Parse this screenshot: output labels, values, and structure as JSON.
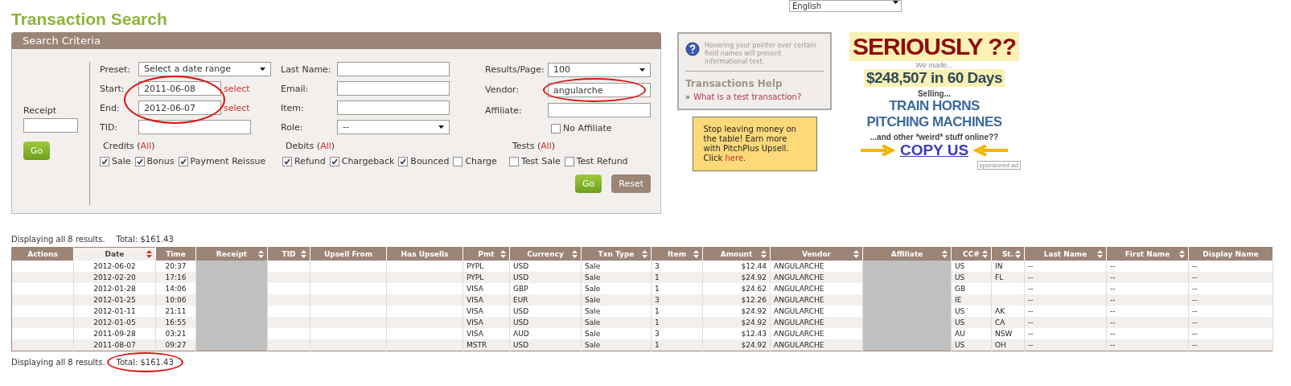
{
  "title": "Transaction Search",
  "language": {
    "value": "English"
  },
  "search_criteria": {
    "title": "Search Criteria",
    "receipt": {
      "label": "Receipt",
      "button": "Go"
    },
    "columns": [
      [
        {
          "kind": "select",
          "label": "Preset:",
          "value": "Select a date range"
        },
        {
          "kind": "date",
          "label": "Start:",
          "value": "2011-06-08",
          "link": "select"
        },
        {
          "kind": "date",
          "label": "End:",
          "value": "2012-06-07",
          "link": "select"
        },
        {
          "kind": "input",
          "label": "TID:"
        }
      ],
      [
        {
          "kind": "input",
          "label": "Last Name:"
        },
        {
          "kind": "input",
          "label": "Email:"
        },
        {
          "kind": "input",
          "label": "Item:"
        },
        {
          "kind": "select",
          "label": "Role:",
          "value": "--"
        }
      ],
      [
        {
          "kind": "select",
          "label": "Results/Page:",
          "value": "100"
        },
        {
          "kind": "input",
          "label": "Vendor:",
          "value": "angularche"
        },
        {
          "kind": "input",
          "label": "Affiliate:"
        },
        {
          "kind": "check",
          "label": "No Affiliate",
          "checked": false
        }
      ]
    ],
    "groups": [
      {
        "title": "Credits",
        "open": "(",
        "all": "All",
        "close": ")",
        "options": [
          {
            "label": "Sale",
            "checked": true
          },
          {
            "label": "Bonus",
            "checked": true
          },
          {
            "label": "Payment Reissue",
            "checked": true
          }
        ]
      },
      {
        "title": "Debits",
        "open": "(",
        "all": "All",
        "close": ")",
        "options": [
          {
            "label": "Refund",
            "checked": true
          },
          {
            "label": "Chargeback",
            "checked": true
          },
          {
            "label": "Bounced",
            "checked": true
          },
          {
            "label": "Charge",
            "checked": false
          }
        ]
      },
      {
        "title": "Tests",
        "open": "(",
        "all": "All",
        "close": ")",
        "options": [
          {
            "label": "Test Sale",
            "checked": false
          },
          {
            "label": "Test Refund",
            "checked": false
          }
        ]
      }
    ],
    "buttons": [
      {
        "kind": "primary",
        "label": "Go"
      },
      {
        "kind": "secondary",
        "label": "Reset"
      }
    ]
  },
  "help": {
    "hint": "Hovering your pointer over certain field names will present informational text.",
    "title": "Transactions Help",
    "bullet": "»",
    "link": "What is a test transaction?"
  },
  "promo": {
    "text": "Stop leaving money on the table! Earn more with PitchPlus Upsell. Click",
    "link": "here",
    "after": "."
  },
  "ad": {
    "headline": "SERIOUSLY ??",
    "intro": "We made...",
    "amount": "$248,507 in 60 Days",
    "selling": "Selling...",
    "products": [
      "TRAIN HORNS",
      "PITCHING MACHINES"
    ],
    "tagline": "...and other *weird* stuff online??",
    "cta": "COPY US",
    "label": "sponsored ad"
  },
  "summary_top": {
    "count": "Displaying all 8 results.",
    "total": "Total: $161.43"
  },
  "table": {
    "columns": [
      {
        "label": "Actions",
        "kind": "text",
        "sortable": false,
        "sorted": false
      },
      {
        "label": "Date",
        "kind": "center",
        "sortable": true,
        "sorted": true
      },
      {
        "label": "Time",
        "kind": "center",
        "sortable": false,
        "sorted": false
      },
      {
        "label": "Receipt",
        "kind": "redacted",
        "sortable": true,
        "sorted": false
      },
      {
        "label": "TID",
        "kind": "text",
        "sortable": true,
        "sorted": false
      },
      {
        "label": "Upsell From",
        "kind": "text",
        "sortable": false,
        "sorted": false
      },
      {
        "label": "Has Upsells",
        "kind": "text",
        "sortable": false,
        "sorted": false
      },
      {
        "label": "Pmt",
        "kind": "text",
        "sortable": true,
        "sorted": false
      },
      {
        "label": "Currency",
        "kind": "text",
        "sortable": true,
        "sorted": false
      },
      {
        "label": "Txn Type",
        "kind": "text",
        "sortable": true,
        "sorted": false
      },
      {
        "label": "Item",
        "kind": "text",
        "sortable": true,
        "sorted": false
      },
      {
        "label": "Amount",
        "kind": "right",
        "sortable": true,
        "sorted": false
      },
      {
        "label": "Vendor",
        "kind": "text",
        "sortable": true,
        "sorted": false
      },
      {
        "label": "Affiliate",
        "kind": "redacted",
        "sortable": true,
        "sorted": false
      },
      {
        "label": "CC#",
        "kind": "text",
        "sortable": true,
        "sorted": false
      },
      {
        "label": "St.",
        "kind": "text",
        "sortable": true,
        "sorted": false
      },
      {
        "label": "Last Name",
        "kind": "text",
        "sortable": true,
        "sorted": false
      },
      {
        "label": "First Name",
        "kind": "text",
        "sortable": true,
        "sorted": false
      },
      {
        "label": "Display Name",
        "kind": "text",
        "sortable": false,
        "sorted": false
      }
    ],
    "rows": [
      [
        null,
        "2012-06-02",
        "20:37",
        null,
        null,
        null,
        null,
        "PYPL",
        "USD",
        "Sale",
        "3",
        "$12.44",
        "ANGULARCHE",
        null,
        "US",
        "IN",
        "--",
        "--",
        "--"
      ],
      [
        null,
        "2012-02-20",
        "17:16",
        null,
        null,
        null,
        null,
        "PYPL",
        "USD",
        "Sale",
        "1",
        "$24.92",
        "ANGULARCHE",
        null,
        "US",
        "FL",
        "--",
        "--",
        "--"
      ],
      [
        null,
        "2012-01-28",
        "14:06",
        null,
        null,
        null,
        null,
        "VISA",
        "GBP",
        "Sale",
        "1",
        "$24.62",
        "ANGULARCHE",
        null,
        "GB",
        null,
        "--",
        "--",
        "--"
      ],
      [
        null,
        "2012-01-25",
        "10:06",
        null,
        null,
        null,
        null,
        "VISA",
        "EUR",
        "Sale",
        "3",
        "$12.26",
        "ANGULARCHE",
        null,
        "IE",
        null,
        "--",
        "--",
        "--"
      ],
      [
        null,
        "2012-01-11",
        "21:11",
        null,
        null,
        null,
        null,
        "VISA",
        "USD",
        "Sale",
        "1",
        "$24.92",
        "ANGULARCHE",
        null,
        "US",
        "AK",
        "--",
        "--",
        "--"
      ],
      [
        null,
        "2012-01-05",
        "16:55",
        null,
        null,
        null,
        null,
        "VISA",
        "USD",
        "Sale",
        "1",
        "$24.92",
        "ANGULARCHE",
        null,
        "US",
        "CA",
        "--",
        "--",
        "--"
      ],
      [
        null,
        "2011-09-28",
        "03:21",
        null,
        null,
        null,
        null,
        "VISA",
        "AUD",
        "Sale",
        "3",
        "$12.43",
        "ANGULARCHE",
        null,
        "AU",
        "NSW",
        "--",
        "--",
        "--"
      ],
      [
        null,
        "2011-08-07",
        "09:27",
        null,
        null,
        null,
        null,
        "MSTR",
        "USD",
        "Sale",
        "1",
        "$24.92",
        "ANGULARCHE",
        null,
        "US",
        "OH",
        "--",
        "--",
        "--"
      ]
    ]
  },
  "summary_bottom": {
    "count": "Displaying all 8 results.",
    "total": "Total: $161.43"
  }
}
